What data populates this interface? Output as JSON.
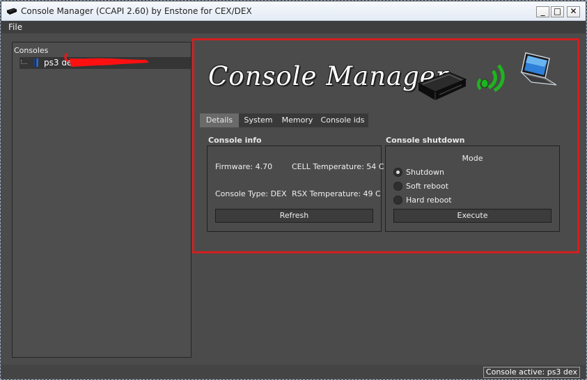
{
  "window": {
    "title": "Console Manager (CCAPI 2.60) by Enstone for CEX/DEX"
  },
  "menu": {
    "file": "File"
  },
  "tree": {
    "header": "Consoles",
    "item_label": "ps3 dex :"
  },
  "banner": {
    "title": "Console Manager"
  },
  "tabs": [
    {
      "label": "Details",
      "active": true
    },
    {
      "label": "System",
      "active": false
    },
    {
      "label": "Memory",
      "active": false
    },
    {
      "label": "Console ids",
      "active": false
    }
  ],
  "console_info": {
    "title": "Console info",
    "firmware": "Firmware: 4.70",
    "cell_temp": "CELL Temperature: 54 C",
    "console_type": "Console Type: DEX",
    "rsx_temp": "RSX Temperature: 49 C",
    "refresh_label": "Refresh"
  },
  "console_shutdown": {
    "title": "Console shutdown",
    "mode_label": "Mode",
    "options": [
      {
        "label": "Shutdown",
        "checked": true
      },
      {
        "label": "Soft reboot",
        "checked": false
      },
      {
        "label": "Hard reboot",
        "checked": false
      }
    ],
    "execute_label": "Execute"
  },
  "status": {
    "active": "Console active: ps3 dex"
  },
  "colors": {
    "highlight_border": "#d41e1e",
    "wifi_green": "#1fb41f",
    "background": "#4b4b4b"
  },
  "icons": {
    "app": "ps3-console-icon",
    "tree_node": "ps3-console-icon",
    "banner_console": "ps3-console-icon",
    "banner_wifi": "wifi-signal-icon",
    "banner_laptop": "laptop-icon"
  }
}
